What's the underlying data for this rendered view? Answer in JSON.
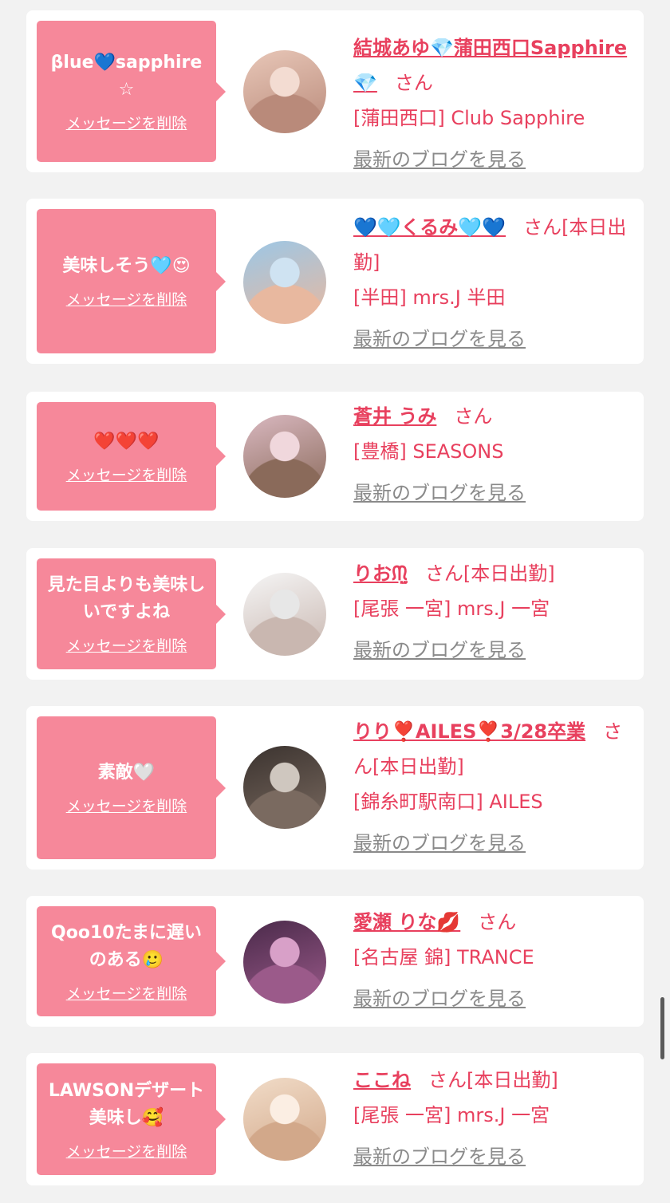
{
  "delete_label": "メッセージを削除",
  "blog_label": "最新のブログを見る",
  "san_label": "さん",
  "colors": {
    "page_bg": "#f2f2f2",
    "card_bg": "#ffffff",
    "bubble_bg": "#f6889a",
    "accent": "#e8405e",
    "link_gray": "#8a8a8a"
  },
  "items": [
    {
      "message": "βlue💙sapphire☆",
      "name": "結城あゆ💎蒲田西口Sapphire💎",
      "status": "",
      "shop": "[蒲田西口] Club Sapphire",
      "avatar_icon": "woman-portrait-icon"
    },
    {
      "message": "美味しそう🩵😍",
      "name": "💙🩵くるみ🩵💙",
      "status": "[本日出勤]",
      "shop": "[半田] mrs.J 半田",
      "avatar_icon": "woman-portrait-icon"
    },
    {
      "message": "❤️❤️❤️",
      "name": "蒼井 うみ",
      "status": "",
      "shop": "[豊橋] SEASONS",
      "avatar_icon": "woman-portrait-icon"
    },
    {
      "message": "見た目よりも美味しいですよね",
      "name": "りおᙏ̤̫",
      "status": "[本日出勤]",
      "shop": "[尾張 一宮] mrs.J 一宮",
      "avatar_icon": "woman-portrait-icon"
    },
    {
      "message": "素敵🤍",
      "name": "りり❣️AILES❣️3/28卒業",
      "status": "[本日出勤]",
      "shop": "[錦糸町駅南口] AILES",
      "avatar_icon": "woman-portrait-icon"
    },
    {
      "message": "Qoo10たまに遅いのある🥲",
      "name": "愛瀬 りな💋",
      "status": "",
      "shop": "[名古屋 錦] TRANCE",
      "avatar_icon": "woman-portrait-icon"
    },
    {
      "message": "LAWSONデザート美味し🥰",
      "name": "ここね",
      "status": "[本日出勤]",
      "shop": "[尾張 一宮] mrs.J 一宮",
      "avatar_icon": "woman-portrait-icon"
    }
  ]
}
